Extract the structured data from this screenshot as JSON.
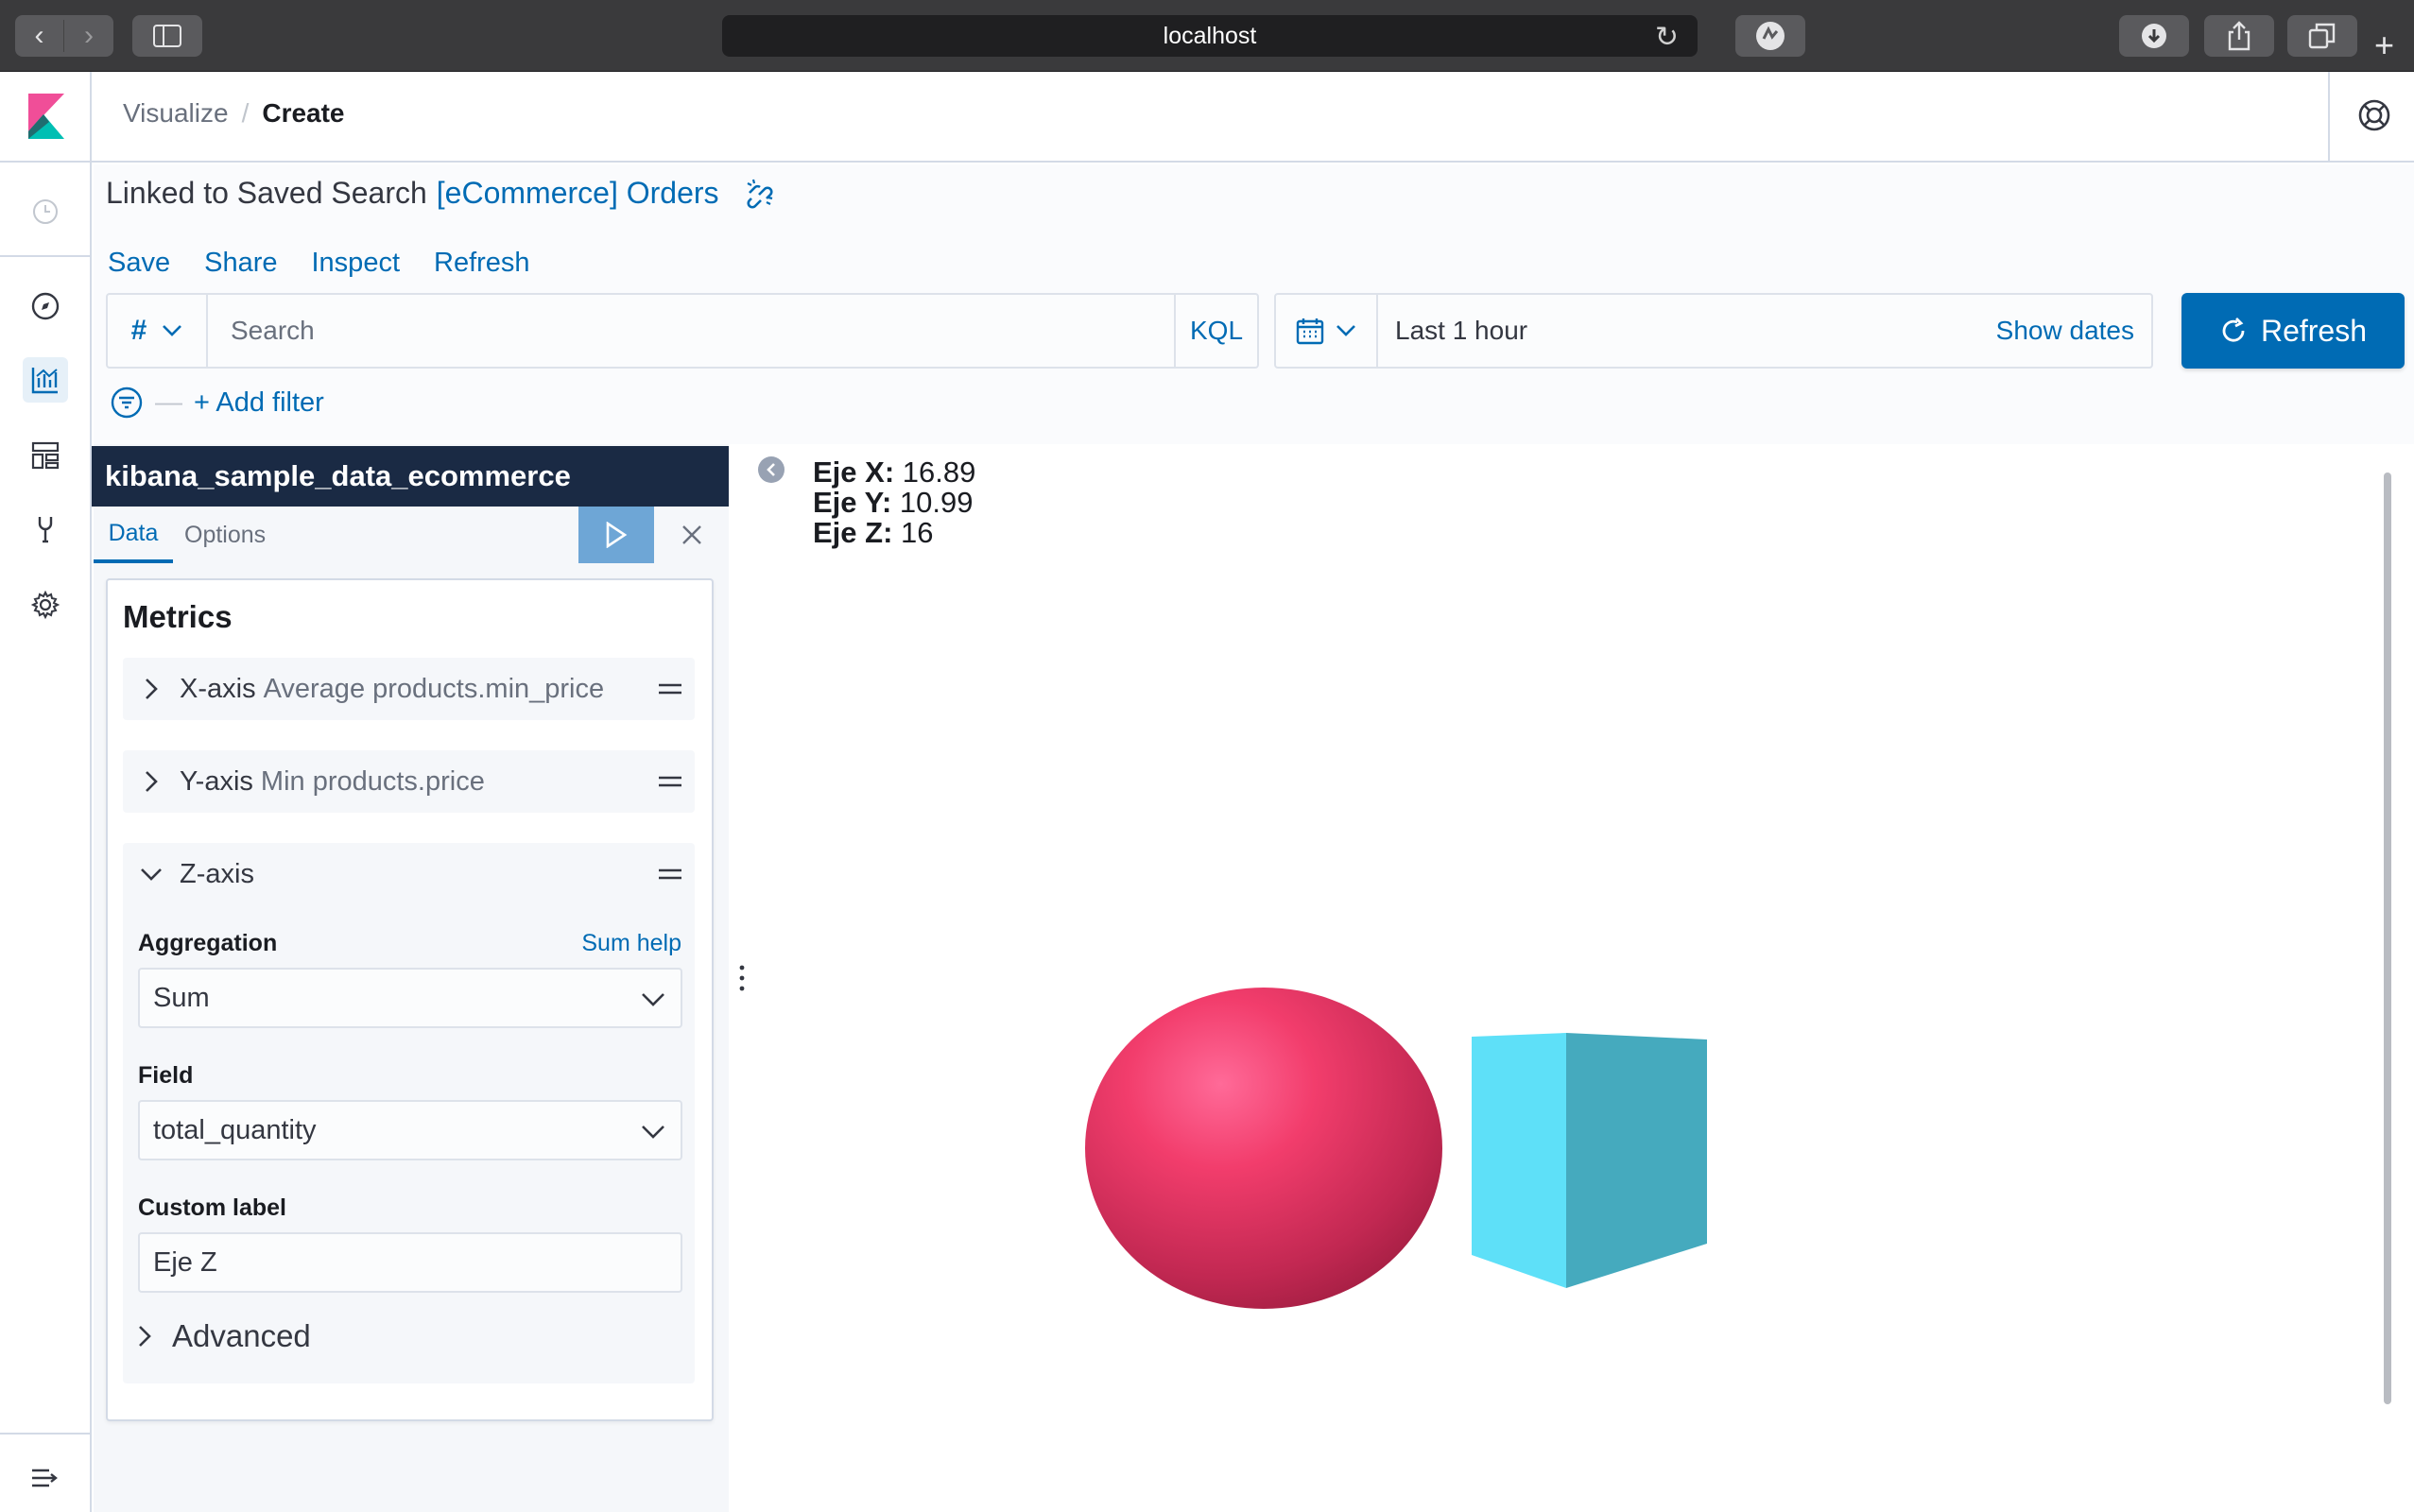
{
  "browser": {
    "url": "localhost"
  },
  "breadcrumb": {
    "parent": "Visualize",
    "separator": "/",
    "current": "Create"
  },
  "linked": {
    "prefix": "Linked to Saved Search",
    "search_name": "[eCommerce] Orders"
  },
  "top_menu": {
    "save": "Save",
    "share": "Share",
    "inspect": "Inspect",
    "refresh": "Refresh"
  },
  "query": {
    "language_symbol": "#",
    "placeholder": "Search",
    "language": "KQL"
  },
  "time": {
    "range": "Last 1 hour",
    "show_dates": "Show dates",
    "refresh_label": "Refresh"
  },
  "filter": {
    "add_label": "+ Add filter"
  },
  "sidebar": {
    "index_pattern": "kibana_sample_data_ecommerce",
    "tabs": [
      "Data",
      "Options"
    ],
    "metrics_title": "Metrics",
    "aggs": [
      {
        "name": "X-axis",
        "description": "Average products.min_price"
      },
      {
        "name": "Y-axis",
        "description": "Min products.price"
      },
      {
        "name": "Z-axis",
        "description": ""
      }
    ],
    "aggregation_label": "Aggregation",
    "aggregation_help": "Sum help",
    "aggregation_value": "Sum",
    "field_label": "Field",
    "field_value": "total_quantity",
    "custom_label_label": "Custom label",
    "custom_label_value": "Eje Z",
    "advanced": "Advanced"
  },
  "readout": [
    {
      "label": "Eje X:",
      "value": "16.89"
    },
    {
      "label": "Eje Y:",
      "value": "10.99"
    },
    {
      "label": "Eje Z:",
      "value": "16"
    }
  ],
  "colors": {
    "accent": "#006bb4",
    "sphere": "#f03c6a",
    "cube": "#5ee0f8",
    "index_header": "#1a2a44"
  }
}
